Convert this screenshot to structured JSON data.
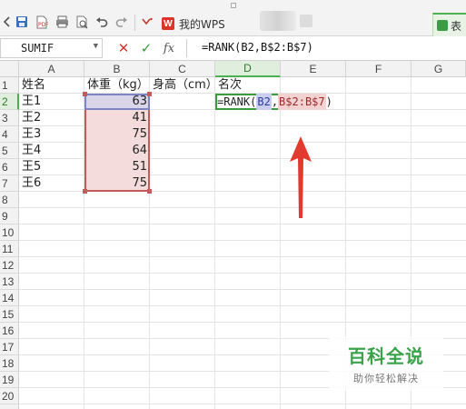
{
  "toolbar": {
    "tab_label": "我的WPS",
    "wps_logo": "W",
    "add_tab_label": "表",
    "icons": [
      "chevron-left-icon",
      "save-icon",
      "export-pdf-icon",
      "print-icon",
      "print-preview-icon",
      "undo-icon",
      "redo-icon",
      "dropdown-icon"
    ]
  },
  "formula_bar": {
    "namebox": "SUMIF",
    "cancel_symbol": "✕",
    "confirm_symbol": "✓",
    "fx_label": "fx",
    "formula_text": "=RANK(B2,B$2:B$7)"
  },
  "columns": [
    "A",
    "B",
    "C",
    "D",
    "E",
    "F",
    "G"
  ],
  "active_column": "D",
  "rows": [
    "1",
    "2",
    "3",
    "4",
    "5",
    "6",
    "7",
    "8",
    "9",
    "10",
    "11",
    "12",
    "13",
    "14",
    "15",
    "16",
    "17",
    "18",
    "19",
    "20"
  ],
  "active_row": "2",
  "sheet": {
    "headers": {
      "a1": "姓名",
      "b1": "体重（kg）",
      "c1": "身高（cm）",
      "d1": "名次"
    },
    "names": [
      "王1",
      "王2",
      "王3",
      "王4",
      "王5",
      "王6"
    ],
    "weights": [
      "63",
      "41",
      "75",
      "64",
      "51",
      "75"
    ],
    "d2_edit": {
      "prefix": "=RANK(",
      "ref1": "B2",
      "comma": ",",
      "ref2": "B$2:B$7",
      "suffix": ")"
    }
  },
  "colors": {
    "range_fill": "#f4dcdc",
    "range_border": "#c55b5b",
    "ref_fill": "#c9cef0",
    "active_green": "#4caf50",
    "arrow_red": "#e23a2e"
  },
  "watermark": {
    "title": "百科全说",
    "subtitle": "助你轻松解决"
  }
}
